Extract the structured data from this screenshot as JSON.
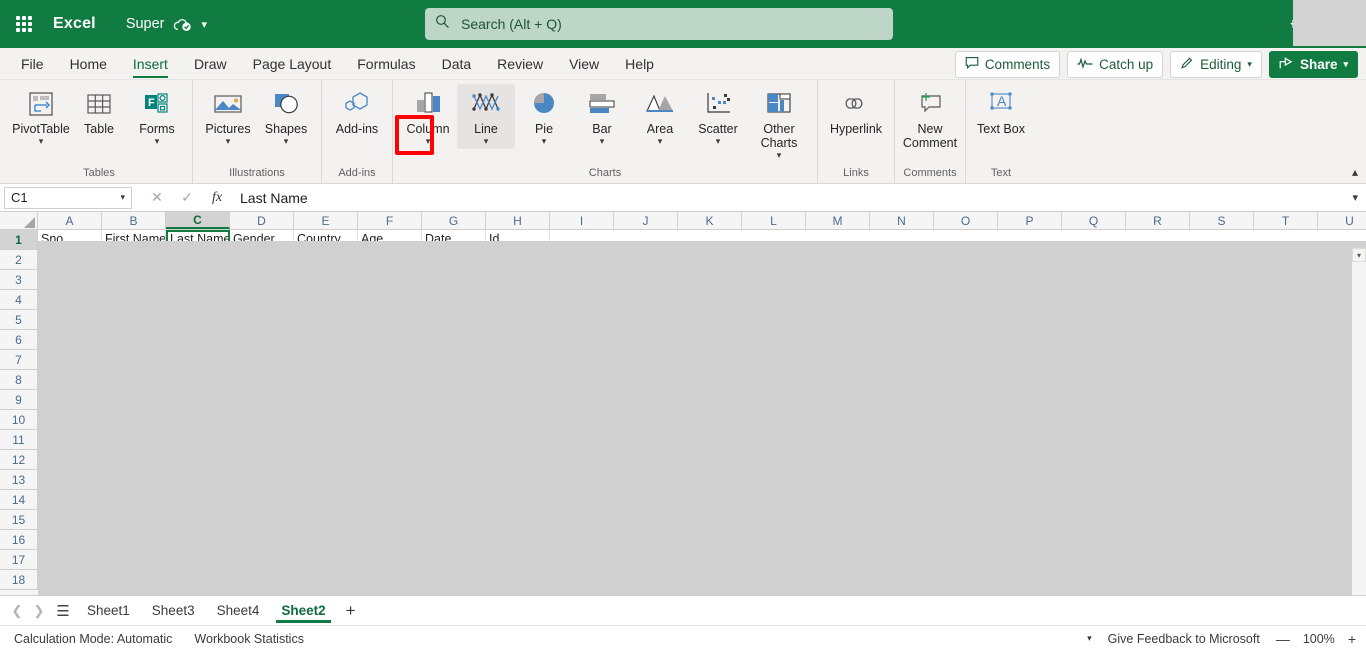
{
  "titlebar": {
    "app_name": "Excel",
    "document_name": "Super",
    "autosave_icon": "cloud-saved-icon",
    "dropdown_icon": "chevron-down-icon",
    "waffle_icon": "app-launcher-icon",
    "settings_icon": "gear-icon"
  },
  "search": {
    "placeholder": "Search (Alt + Q)",
    "value": "",
    "icon": "search-icon"
  },
  "ribbon_tabs": [
    {
      "label": "File",
      "active": false
    },
    {
      "label": "Home",
      "active": false
    },
    {
      "label": "Insert",
      "active": true
    },
    {
      "label": "Draw",
      "active": false
    },
    {
      "label": "Page Layout",
      "active": false
    },
    {
      "label": "Formulas",
      "active": false
    },
    {
      "label": "Data",
      "active": false
    },
    {
      "label": "Review",
      "active": false
    },
    {
      "label": "View",
      "active": false
    },
    {
      "label": "Help",
      "active": false
    }
  ],
  "tabbar_actions": {
    "comments": "Comments",
    "catch_up": "Catch up",
    "editing": "Editing",
    "share": "Share",
    "comments_icon": "comment-bubble-icon",
    "catchup_icon": "activity-pulse-icon",
    "editing_icon": "pencil-icon",
    "share_icon": "share-arrow-icon",
    "editing_chevron": "chevron-down-icon",
    "share_chevron": "chevron-down-icon"
  },
  "ribbon": {
    "collapse_icon": "chevron-up-icon",
    "groups": [
      {
        "label": "Tables",
        "items": [
          {
            "label": "PivotTable",
            "icon": "pivot-table-icon",
            "has_chevron": true
          },
          {
            "label": "Table",
            "icon": "table-icon",
            "has_chevron": false
          },
          {
            "label": "Forms",
            "icon": "forms-icon",
            "has_chevron": true
          }
        ]
      },
      {
        "label": "Illustrations",
        "items": [
          {
            "label": "Pictures",
            "icon": "pictures-icon",
            "has_chevron": true
          },
          {
            "label": "Shapes",
            "icon": "shapes-icon",
            "has_chevron": true
          }
        ]
      },
      {
        "label": "Add-ins",
        "items": [
          {
            "label": "Add-ins",
            "icon": "add-ins-icon",
            "has_chevron": false
          }
        ]
      },
      {
        "label": "Charts",
        "items": [
          {
            "label": "Column",
            "icon": "column-chart-icon",
            "has_chevron": true
          },
          {
            "label": "Line",
            "icon": "line-chart-icon",
            "has_chevron": true,
            "highlighted": true
          },
          {
            "label": "Pie",
            "icon": "pie-chart-icon",
            "has_chevron": true
          },
          {
            "label": "Bar",
            "icon": "bar-chart-icon",
            "has_chevron": true
          },
          {
            "label": "Area",
            "icon": "area-chart-icon",
            "has_chevron": true
          },
          {
            "label": "Scatter",
            "icon": "scatter-chart-icon",
            "has_chevron": true
          },
          {
            "label": "Other Charts",
            "icon": "other-charts-icon",
            "has_chevron": true
          }
        ]
      },
      {
        "label": "Links",
        "items": [
          {
            "label": "Hyperlink",
            "icon": "hyperlink-icon",
            "has_chevron": false
          }
        ]
      },
      {
        "label": "Comments",
        "items": [
          {
            "label": "New Comment",
            "icon": "new-comment-icon",
            "has_chevron": false
          }
        ]
      },
      {
        "label": "Text",
        "items": [
          {
            "label": "Text Box",
            "icon": "text-box-icon",
            "has_chevron": false
          }
        ]
      }
    ]
  },
  "formula_bar": {
    "name_box_value": "C1",
    "name_box_chevron": "chevron-down-icon",
    "cancel_icon": "close-icon",
    "confirm_icon": "check-icon",
    "function_icon": "fx-icon",
    "cancel_label": "✕",
    "confirm_label": "✓",
    "function_label": "fx",
    "content": "Last Name",
    "expand_icon": "chevron-down-icon"
  },
  "grid": {
    "columns": [
      "A",
      "B",
      "C",
      "D",
      "E",
      "F",
      "G",
      "H",
      "I",
      "J",
      "K",
      "L",
      "M",
      "N",
      "O",
      "P",
      "Q",
      "R",
      "S",
      "T",
      "U"
    ],
    "selected_column": "C",
    "selected_row": "1",
    "selected_cell": "C1",
    "rows": [
      "1",
      "2",
      "3",
      "4",
      "5",
      "6",
      "7",
      "8",
      "9",
      "10",
      "11",
      "12",
      "13",
      "14",
      "15",
      "16",
      "17",
      "18"
    ],
    "row1_values": [
      "Sno",
      "First Name",
      "Last Name",
      "Gender",
      "Country",
      "Age",
      "Date",
      "Id"
    ],
    "scroll_down_icon": "chevron-down-icon"
  },
  "sheet_tabs": {
    "prev_icon": "chevron-left-icon",
    "next_icon": "chevron-right-icon",
    "list_icon": "sheet-list-icon",
    "add_icon": "plus-icon",
    "tabs": [
      {
        "label": "Sheet1",
        "active": false
      },
      {
        "label": "Sheet3",
        "active": false
      },
      {
        "label": "Sheet4",
        "active": false
      },
      {
        "label": "Sheet2",
        "active": true
      }
    ]
  },
  "status_bar": {
    "calculation_mode": "Calculation Mode: Automatic",
    "workbook_statistics": "Workbook Statistics",
    "options_chevron": "chevron-down-icon",
    "feedback": "Give Feedback to Microsoft",
    "zoom_out_label": "—",
    "zoom_level": "100%",
    "zoom_in_label": "+",
    "zoom_out_icon": "minus-icon",
    "zoom_in_icon": "plus-icon"
  },
  "colors": {
    "brand_green": "#107c41",
    "accent_green": "#0f6b3d",
    "annotation_red": "#ff0000",
    "ribbon_bg": "#f3f2f1",
    "search_bg": "#bdd6c7"
  }
}
